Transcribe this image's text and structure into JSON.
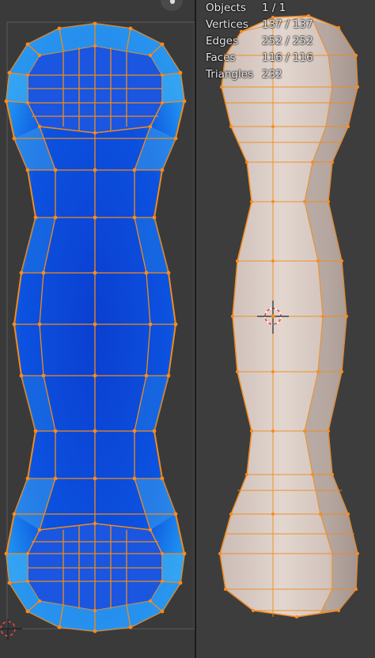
{
  "overlay": {
    "stats": [
      {
        "label": "Objects",
        "value": "1 / 1"
      },
      {
        "label": "Vertices",
        "value": "137 / 137"
      },
      {
        "label": "Edges",
        "value": "252 / 252"
      },
      {
        "label": "Faces",
        "value": "116 / 116"
      },
      {
        "label": "Triangles",
        "value": "232"
      }
    ]
  },
  "colors": {
    "uv_background": "#3a3a3a",
    "uv_face_fill": "#0b4bd8",
    "uv_face_light": "#2a9bf0",
    "edge_highlight": "#f08a1c",
    "mesh_surface": "#d9cbc4",
    "mesh_shadow": "#b8a79e",
    "viewport_background": "#3d3d3d"
  },
  "icons": {
    "uv_2d_cursor": "2d-cursor-icon",
    "viewport_3d_cursor": "3d-cursor-icon",
    "gizmo": "hand-tool-icon"
  }
}
